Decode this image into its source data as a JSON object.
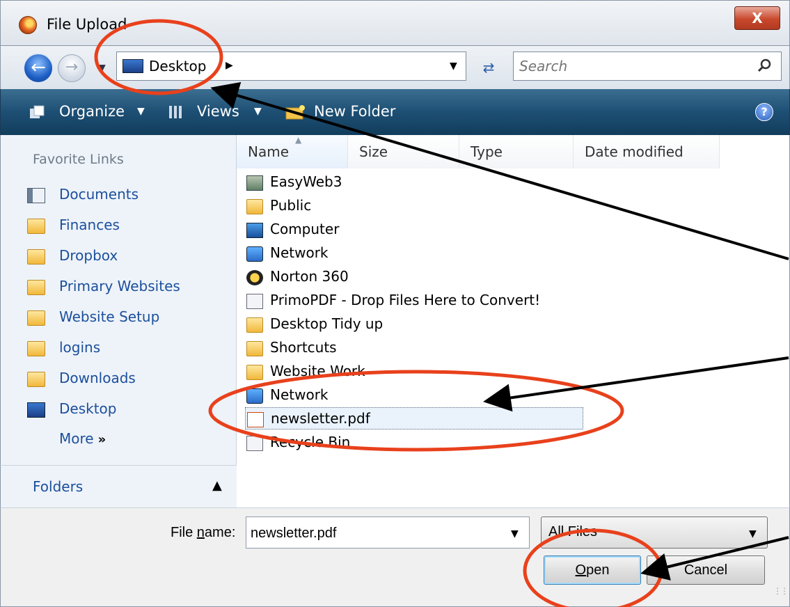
{
  "window": {
    "title": "File Upload",
    "close_glyph": "X"
  },
  "address": {
    "location": "Desktop",
    "search_placeholder": "Search"
  },
  "toolbar": {
    "organize": "Organize",
    "views": "Views",
    "new_folder": "New Folder",
    "help": "?"
  },
  "nav": {
    "heading": "Favorite Links",
    "items": [
      {
        "label": "Documents",
        "icon": "documents-icon"
      },
      {
        "label": "Finances",
        "icon": "folder-icon"
      },
      {
        "label": "Dropbox",
        "icon": "dropbox-icon"
      },
      {
        "label": "Primary Websites",
        "icon": "folder-icon"
      },
      {
        "label": "Website Setup",
        "icon": "folder-icon"
      },
      {
        "label": "logins",
        "icon": "folder-icon"
      },
      {
        "label": "Downloads",
        "icon": "folder-icon"
      },
      {
        "label": "Desktop",
        "icon": "desktop-icon"
      }
    ],
    "more": "More",
    "more_glyph": "»",
    "folders": "Folders"
  },
  "columns": [
    "Name",
    "Size",
    "Type",
    "Date modified"
  ],
  "files": [
    {
      "label": "EasyWeb3",
      "icon": "easyweb-icon"
    },
    {
      "label": "Public",
      "icon": "folder-icon"
    },
    {
      "label": "Computer",
      "icon": "computer-icon"
    },
    {
      "label": "Network",
      "icon": "network-icon"
    },
    {
      "label": "Norton 360",
      "icon": "norton-icon"
    },
    {
      "label": "PrimoPDF - Drop Files Here to Convert!",
      "icon": "shortcut-icon"
    },
    {
      "label": "Desktop Tidy up",
      "icon": "folder-icon"
    },
    {
      "label": "Shortcuts",
      "icon": "folder-icon"
    },
    {
      "label": "Website Work",
      "icon": "folder-icon"
    },
    {
      "label": "Network",
      "icon": "network-shortcut-icon"
    },
    {
      "label": "newsletter.pdf",
      "icon": "pdf-icon",
      "selected": true
    },
    {
      "label": "Recycle Bin",
      "icon": "recycle-bin-icon"
    }
  ],
  "bottom": {
    "file_name_label_pre": "File ",
    "file_name_label_mnemonic": "n",
    "file_name_label_post": "ame:",
    "file_name_value": "newsletter.pdf",
    "file_type": "All Files",
    "open_mnemonic": "O",
    "open_rest": "pen",
    "cancel": "Cancel"
  },
  "colors": {
    "annotation_circle": "#e8411c",
    "annotation_arrow": "#000000",
    "toolbar_bg": "#1d4f74",
    "link_blue": "#1b4f9c"
  }
}
